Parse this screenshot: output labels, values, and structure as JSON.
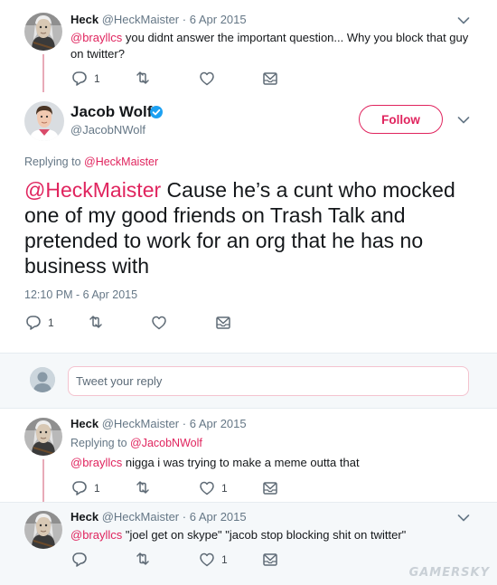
{
  "tweet1": {
    "name": "Heck",
    "handle": "@HeckMaister",
    "date": "6 Apr 2015",
    "mention": "@brayllcs",
    "text": " you didnt answer the important question... Why you block that guy on twitter?",
    "replies": "1",
    "retweets": "",
    "likes": ""
  },
  "main_tweet": {
    "name": "Jacob Wolf",
    "handle": "@JacobNWolf",
    "follow_label": "Follow",
    "replying_prefix": "Replying to ",
    "replying_to": "@HeckMaister",
    "mention": "@HeckMaister",
    "text": " Cause he’s a cunt who mocked one of my good friends on Trash Talk and pretended to work for an org that he has no business with",
    "timestamp": "12:10 PM - 6 Apr 2015",
    "replies": "1",
    "retweets": "",
    "likes": ""
  },
  "reply_box": {
    "placeholder": "Tweet your reply"
  },
  "tweet3": {
    "name": "Heck",
    "handle": "@HeckMaister",
    "date": "6 Apr 2015",
    "replying_prefix": "Replying to ",
    "replying_to": "@JacobNWolf",
    "mention": "@brayllcs",
    "text": " nigga i was trying to make a meme outta that",
    "replies": "1",
    "retweets": "",
    "likes": "1"
  },
  "tweet4": {
    "name": "Heck",
    "handle": "@HeckMaister",
    "date": "6 Apr 2015",
    "mention": "@brayllcs",
    "text": " \"joel get on skype\" \"jacob stop blocking shit on twitter\"",
    "replies": "",
    "retweets": "",
    "likes": "1"
  },
  "watermark": "GAMERSKY",
  "colors": {
    "accent": "#e0245e",
    "verified": "#1da1f2",
    "thread_line": "#e8aab8",
    "muted": "#657786"
  }
}
